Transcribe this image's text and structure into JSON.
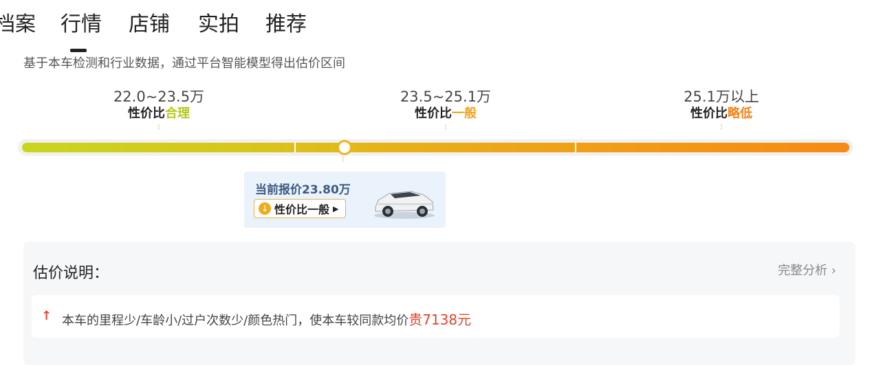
{
  "tabs": [
    {
      "label": "档案"
    },
    {
      "label": "行情",
      "active": true
    },
    {
      "label": "店铺"
    },
    {
      "label": "实拍"
    },
    {
      "label": "推荐"
    }
  ],
  "subtitle": "基于本车检测和行业数据，通过平台智能模型得出估价区间",
  "tiers": [
    {
      "range": "22.0~23.5万",
      "label_prefix": "性价比",
      "label_level": "合理",
      "color": "#b6c81a"
    },
    {
      "range": "23.5~25.1万",
      "label_prefix": "性价比",
      "label_level": "一般",
      "color": "#f2a21a"
    },
    {
      "range": "25.1万以上",
      "label_prefix": "性价比",
      "label_level": "略低",
      "color": "#f58216"
    }
  ],
  "current": {
    "price_text": "当前报价23.80万",
    "level_label": "性价比一般",
    "icon": "down-arrow-icon",
    "level_fraction": 0.39
  },
  "panel": {
    "title": "估价说明：",
    "link": "完整分析 ›",
    "reason_prefix": "本车的里程少/车龄小/过户次数少/颜色热门，使本车较同款均价",
    "reason_highlight": "贵7138元"
  },
  "colors": {
    "accent": "#f0b418",
    "highlight": "#e5432a"
  }
}
